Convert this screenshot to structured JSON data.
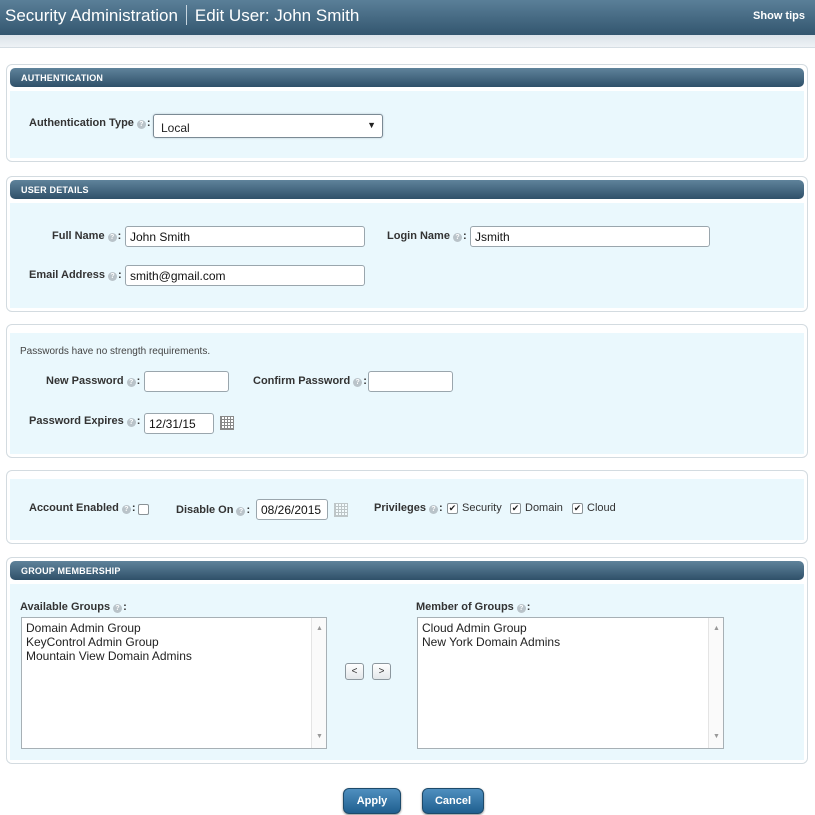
{
  "header": {
    "app_title": "Security Administration",
    "page_title": "Edit User: John Smith",
    "show_tips": "Show tips"
  },
  "authentication": {
    "heading": "AUTHENTICATION",
    "type_label": "Authentication Type",
    "type_value": "Local"
  },
  "user_details": {
    "heading": "USER DETAILS",
    "full_name_label": "Full Name",
    "full_name_value": "John Smith",
    "login_name_label": "Login Name",
    "login_name_value": "Jsmith",
    "email_label": "Email Address",
    "email_value": "smith@gmail.com"
  },
  "password": {
    "note": "Passwords have no strength requirements.",
    "new_label": "New Password",
    "new_value": "",
    "confirm_label": "Confirm Password",
    "confirm_value": "",
    "expires_label": "Password Expires",
    "expires_value": "12/31/15"
  },
  "account": {
    "enabled_label": "Account Enabled",
    "enabled": false,
    "disable_on_label": "Disable On",
    "disable_on_value": "08/26/2015",
    "privileges_label": "Privileges",
    "privileges": [
      {
        "label": "Security",
        "checked": true
      },
      {
        "label": "Domain",
        "checked": true
      },
      {
        "label": "Cloud",
        "checked": true
      }
    ]
  },
  "groups": {
    "heading": "GROUP MEMBERSHIP",
    "available_label": "Available Groups",
    "available": [
      "Domain Admin Group",
      "KeyControl Admin Group",
      "Mountain View Domain Admins"
    ],
    "member_label": "Member of Groups",
    "member": [
      "Cloud Admin Group",
      "New York Domain Admins"
    ],
    "move_left": "<",
    "move_right": ">"
  },
  "actions": {
    "apply": "Apply",
    "cancel": "Cancel"
  }
}
